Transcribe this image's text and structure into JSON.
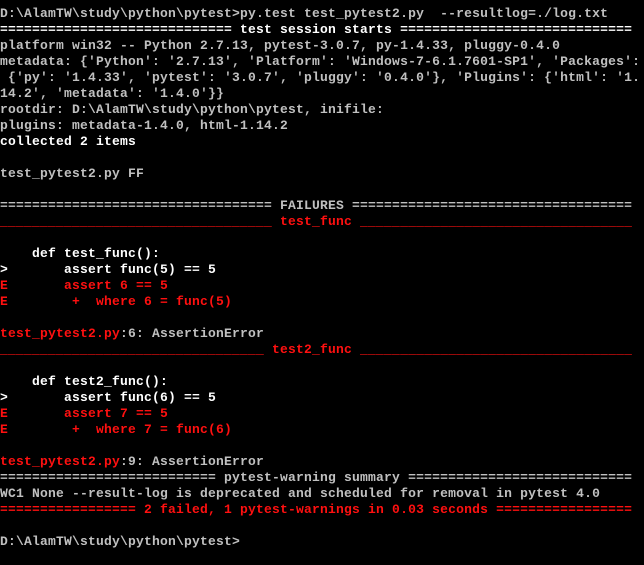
{
  "window": {
    "type": "windows-console",
    "background": "#000000"
  },
  "colors": {
    "g": "#c0c0c0",
    "w": "#ffffff",
    "r": "#ff1010"
  },
  "lines": [
    [
      {
        "t": "D:\\AlamTW\\study\\python\\pytest>py.test test_pytest2.py  --resultlog=./log.txt",
        "c": "g"
      }
    ],
    [
      {
        "t": "============================= test session starts =============================",
        "c": "w"
      }
    ],
    [
      {
        "t": "platform win32 -- Python 2.7.13, pytest-3.0.7, py-1.4.33, pluggy-0.4.0",
        "c": "g"
      }
    ],
    [
      {
        "t": "metadata: {'Python': '2.7.13', 'Platform': 'Windows-7-6.1.7601-SP1', 'Packages':",
        "c": "g"
      }
    ],
    [
      {
        "t": " {'py': '1.4.33', 'pytest': '3.0.7', 'pluggy': '0.4.0'}, 'Plugins': {'html': '1.",
        "c": "g"
      }
    ],
    [
      {
        "t": "14.2', 'metadata': '1.4.0'}}",
        "c": "g"
      }
    ],
    [
      {
        "t": "rootdir: D:\\AlamTW\\study\\python\\pytest, inifile:",
        "c": "g"
      }
    ],
    [
      {
        "t": "plugins: metadata-1.4.0, html-1.14.2",
        "c": "g"
      }
    ],
    [
      {
        "t": "collected 2 items",
        "c": "w"
      }
    ],
    [],
    [
      {
        "t": "test_pytest2.py FF",
        "c": "g"
      }
    ],
    [],
    [
      {
        "t": "================================== FAILURES ===================================",
        "c": "g"
      }
    ],
    [
      {
        "t": "__________________________________ test_func __________________________________",
        "c": "r"
      }
    ],
    [],
    [
      {
        "t": "    def test_func():",
        "c": "w"
      }
    ],
    [
      {
        "t": ">       assert func(5) == 5",
        "c": "w"
      }
    ],
    [
      {
        "t": "E       assert 6 == 5",
        "c": "r"
      }
    ],
    [
      {
        "t": "E        +  where 6 = func(5)",
        "c": "r"
      }
    ],
    [],
    [
      {
        "t": "test_pytest2.py",
        "c": "r"
      },
      {
        "t": ":6: AssertionError",
        "c": "g"
      }
    ],
    [
      {
        "t": "_________________________________ test2_func __________________________________",
        "c": "r"
      }
    ],
    [],
    [
      {
        "t": "    def test2_func():",
        "c": "w"
      }
    ],
    [
      {
        "t": ">       assert func(6) == 5",
        "c": "w"
      }
    ],
    [
      {
        "t": "E       assert 7 == 5",
        "c": "r"
      }
    ],
    [
      {
        "t": "E        +  where 7 = func(6)",
        "c": "r"
      }
    ],
    [],
    [
      {
        "t": "test_pytest2.py",
        "c": "r"
      },
      {
        "t": ":9: AssertionError",
        "c": "g"
      }
    ],
    [
      {
        "t": "=========================== pytest-warning summary ============================",
        "c": "g"
      }
    ],
    [
      {
        "t": "WC1 None --result-log is deprecated and scheduled for removal in pytest 4.0",
        "c": "g"
      }
    ],
    [
      {
        "t": "================= 2 failed, 1 pytest-warnings in 0.03 seconds =================",
        "c": "r"
      }
    ],
    [],
    [
      {
        "t": "D:\\AlamTW\\study\\python\\pytest>",
        "c": "g"
      }
    ]
  ]
}
